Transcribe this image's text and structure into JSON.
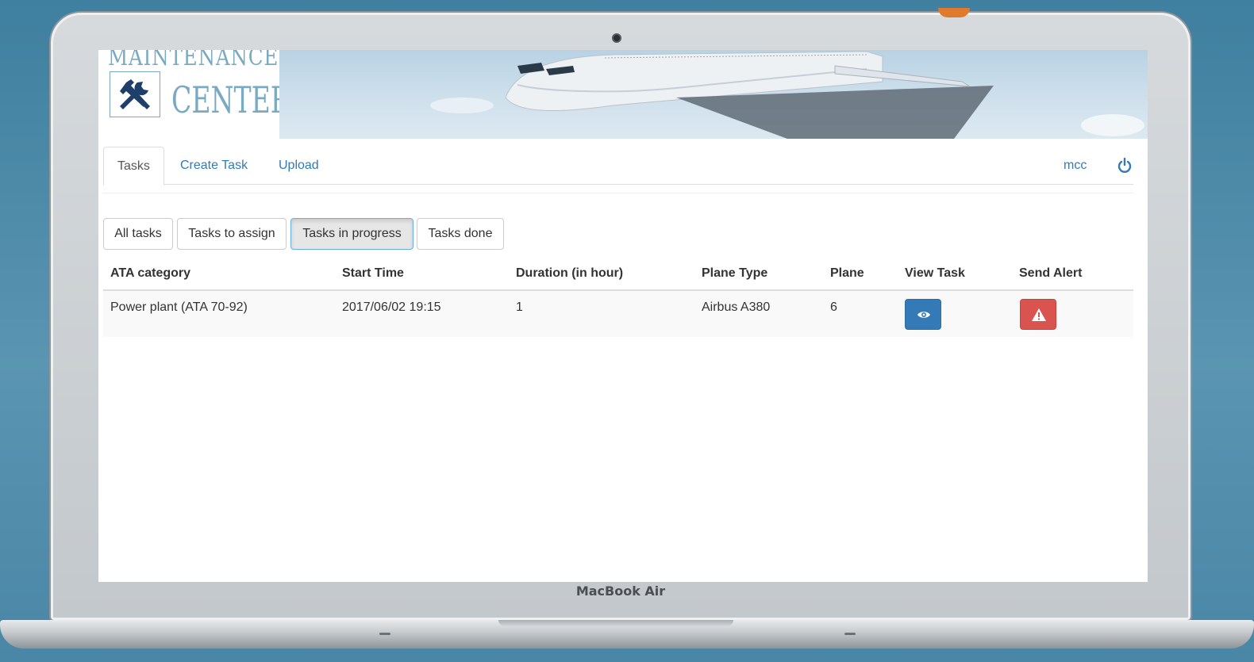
{
  "brand": {
    "laptop_label": "MacBook Air"
  },
  "header": {
    "logo_line1": "MAINTENANCE",
    "logo_line2": "CENTER"
  },
  "nav": {
    "tabs": [
      {
        "label": "Tasks",
        "active": true
      },
      {
        "label": "Create Task",
        "active": false
      },
      {
        "label": "Upload",
        "active": false
      }
    ],
    "user": "mcc",
    "logout_icon": "power-icon"
  },
  "filters": [
    {
      "label": "All tasks",
      "active": false
    },
    {
      "label": "Tasks to assign",
      "active": false
    },
    {
      "label": "Tasks in progress",
      "active": true
    },
    {
      "label": "Tasks done",
      "active": false
    }
  ],
  "table": {
    "columns": [
      "ATA category",
      "Start Time",
      "Duration (in hour)",
      "Plane Type",
      "Plane",
      "View Task",
      "Send Alert"
    ],
    "rows": [
      {
        "ata_category": "Power plant (ATA 70-92)",
        "start_time": "2017/06/02 19:15",
        "duration": "1",
        "plane_type": "Airbus A380",
        "plane": "6",
        "view_icon": "eye-icon",
        "alert_icon": "warning-icon"
      }
    ]
  },
  "colors": {
    "primary": "#337ab7",
    "danger": "#d9534f",
    "logo": "#7aaac2"
  }
}
